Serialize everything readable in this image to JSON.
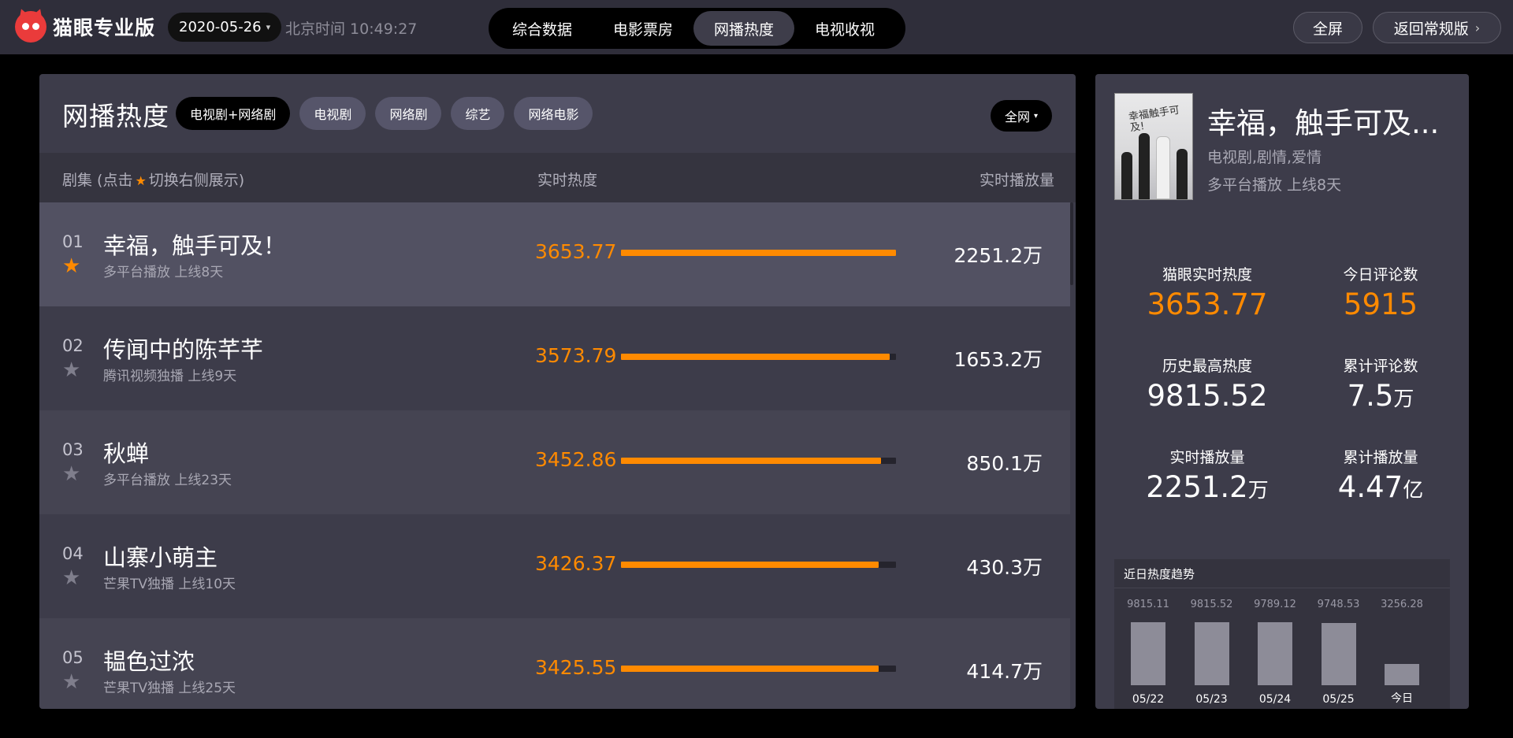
{
  "header": {
    "logo_text": "猫眼专业版",
    "date": "2020-05-26",
    "clock": "北京时间 10:49:27",
    "nav_tabs": [
      {
        "label": "综合数据",
        "active": false
      },
      {
        "label": "电影票房",
        "active": false
      },
      {
        "label": "网播热度",
        "active": true
      },
      {
        "label": "电视收视",
        "active": false
      }
    ],
    "fullscreen_label": "全屏",
    "back_label": "返回常规版"
  },
  "list": {
    "title": "网播热度",
    "filters": [
      {
        "label": "电视剧+网络剧",
        "active": true
      },
      {
        "label": "电视剧",
        "active": false
      },
      {
        "label": "网络剧",
        "active": false
      },
      {
        "label": "综艺",
        "active": false
      },
      {
        "label": "网络电影",
        "active": false
      }
    ],
    "region": "全网",
    "columns": {
      "series_prefix": "剧集 (点击",
      "series_suffix": "切换右侧展示)",
      "heat": "实时热度",
      "plays": "实时播放量"
    },
    "max_heat": 3653.77,
    "rows": [
      {
        "rank": "01",
        "name": "幸福，触手可及！",
        "sub": "多平台播放  上线8天",
        "heat": "3653.77",
        "heat_value": 3653.77,
        "plays": "2251.2万",
        "starred": true
      },
      {
        "rank": "02",
        "name": "传闻中的陈芊芊",
        "sub": "腾讯视频独播  上线9天",
        "heat": "3573.79",
        "heat_value": 3573.79,
        "plays": "1653.2万",
        "starred": false
      },
      {
        "rank": "03",
        "name": "秋蝉",
        "sub": "多平台播放  上线23天",
        "heat": "3452.86",
        "heat_value": 3452.86,
        "plays": "850.1万",
        "starred": false
      },
      {
        "rank": "04",
        "name": "山寨小萌主",
        "sub": "芒果TV独播  上线10天",
        "heat": "3426.37",
        "heat_value": 3426.37,
        "plays": "430.3万",
        "starred": false
      },
      {
        "rank": "05",
        "name": "韫色过浓",
        "sub": "芒果TV独播  上线25天",
        "heat": "3425.55",
        "heat_value": 3425.55,
        "plays": "414.7万",
        "starred": false
      }
    ]
  },
  "detail": {
    "poster_text": "幸福触手可及!",
    "title": "幸福，触手可及...",
    "genre": "电视剧,剧情,爱情",
    "platform": "多平台播放  上线8天",
    "stats": [
      {
        "label": "猫眼实时热度",
        "value": "3653.77",
        "unit": "",
        "orange": true
      },
      {
        "label": "今日评论数",
        "value": "5915",
        "unit": "",
        "orange": true
      },
      {
        "label": "历史最高热度",
        "value": "9815.52",
        "unit": "",
        "orange": false
      },
      {
        "label": "累计评论数",
        "value": "7.5",
        "unit": "万",
        "orange": false
      },
      {
        "label": "实时播放量",
        "value": "2251.2",
        "unit": "万",
        "orange": false
      },
      {
        "label": "累计播放量",
        "value": "4.47",
        "unit": "亿",
        "orange": false
      }
    ],
    "trend_title": "近日热度趋势"
  },
  "chart_data": {
    "type": "bar",
    "title": "近日热度趋势",
    "categories": [
      "05/22",
      "05/23",
      "05/24",
      "05/25",
      "今日"
    ],
    "values": [
      9815.11,
      9815.52,
      9789.12,
      9748.53,
      3256.28
    ],
    "value_labels": [
      "9815.11",
      "9815.52",
      "9789.12",
      "9748.53",
      "3256.28"
    ],
    "xlabel": "",
    "ylabel": "",
    "ylim": [
      0,
      9815.52
    ]
  },
  "colors": {
    "accent": "#ff8a00",
    "panel": "#3d3c4a",
    "topbar": "#2f2e3a"
  }
}
